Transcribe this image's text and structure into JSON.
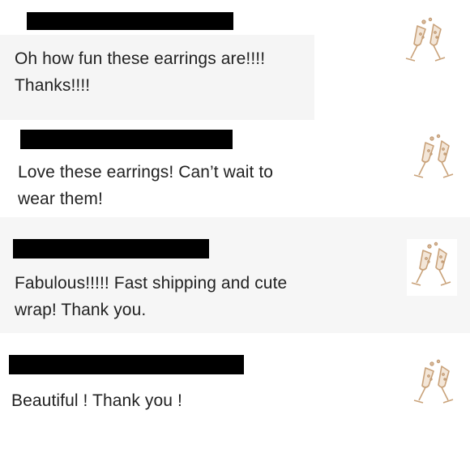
{
  "reviews": [
    {
      "text_line1": "Oh how fun these earrings are!!!!",
      "text_line2": "Thanks!!!!",
      "thumb_icon": "champagne-glasses-earrings-icon"
    },
    {
      "text_line1": "Love these earrings! Can’t wait to",
      "text_line2": "wear them!",
      "thumb_icon": "champagne-glasses-earrings-icon"
    },
    {
      "text_line1": "Fabulous!!!!! Fast shipping and cute",
      "text_line2": "wrap! Thank you.",
      "thumb_icon": "champagne-glasses-earrings-icon"
    },
    {
      "text_line1": "Beautiful ! Thank you !",
      "text_line2": "",
      "thumb_icon": "champagne-glasses-earrings-icon"
    }
  ],
  "colors": {
    "redaction": "#000000",
    "bubble": "#f5f5f5",
    "text": "#222222",
    "earring_gold": "#c9a27a"
  }
}
